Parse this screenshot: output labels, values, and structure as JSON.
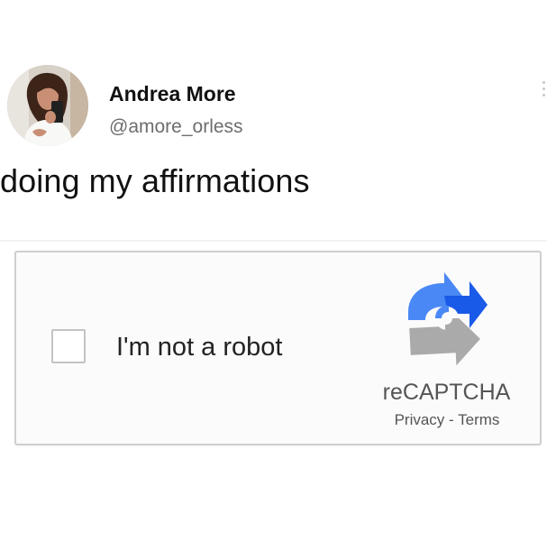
{
  "tweet": {
    "author": {
      "display_name": "Andrea More",
      "handle": "@amore_orless"
    },
    "text": "doing my affirmations",
    "menu_icon": "more-dots-icon"
  },
  "recaptcha": {
    "checkbox_label": "I'm not a robot",
    "checked": false,
    "brand": "reCAPTCHA",
    "links": {
      "privacy": "Privacy",
      "separator": " - ",
      "terms": "Terms"
    },
    "logo_icon": "recaptcha-logo-icon",
    "colors": {
      "blue_dark": "#1a5ae8",
      "blue_light": "#4a88f5",
      "gray": "#aaaaaa",
      "border": "#cfcfcf",
      "background": "#fbfbfb"
    }
  }
}
